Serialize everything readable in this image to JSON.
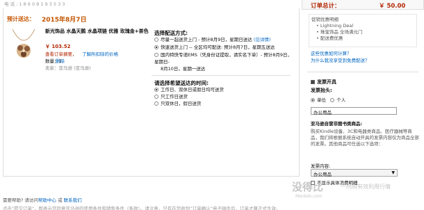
{
  "top_partial": "电 话 : 1 8 6 0 8 1 9 3 5 3 3",
  "shipment": {
    "estimate_label": "预计送达：",
    "estimate_date": "2015年8月7日"
  },
  "product": {
    "title": "新光饰品 水晶天鹅 水晶项链 优雅 玫瑰金+茶色",
    "price": "￥ 103.52",
    "promo_text": "查看订单摘要，",
    "promo_link": "了解所扣除的价格",
    "qty": "数量：1",
    "delete": "删除",
    "seller": "卖家：亚马逊 (亚马逊)"
  },
  "shipping": {
    "title": "选择配送方式:",
    "options": [
      {
        "label": "尽量一起送货上门 - 预计8月9日，星期日送达",
        "link": "(见详情)",
        "selected": false
      },
      {
        "label": "快速送货上门 -- 全区均可配送: 预计8月7日，星期五送达",
        "link": "",
        "selected": true
      },
      {
        "label": "国内特快专递EMS（凭身份证提取，请实名下单）- 预计8月9日，星期日-",
        "link": "",
        "selected": false
      },
      {
        "label": "8月10日，星期一送达",
        "link": "",
        "selected": false
      }
    ]
  },
  "time": {
    "title": "请选择希望送达的时间:",
    "options": [
      {
        "label": "工作日、双休日或假日均可送货",
        "selected": true
      },
      {
        "label": "只工作日送货",
        "selected": false
      },
      {
        "label": "只双休日，假日送货",
        "selected": false
      }
    ]
  },
  "summary": {
    "total_label": "订单总计：",
    "total_value": "￥ 50.00",
    "promos": [
      "促销优惠明细",
      "• Lightning Deal",
      "• 珠宝饰品 全场满元门",
      "• 配送费优惠"
    ],
    "link1": "这些优惠如何计算？",
    "link2": "为什么我没享受到免费配送？"
  },
  "invoice": {
    "need_label": "发票开具",
    "header_label": "发票抬头:",
    "unit_label": "单位",
    "person_label": "个人",
    "header_value": "办公用品",
    "category_label": "亚马逊自营非图书类商品:",
    "desc": "购买Kindle设备、3C和电器类商品、医疗器械等商品，我们将根据系统自动开具的发票内容仅为商品全部的发票。其他商品可任选以下选项：",
    "content_label": "发票内容:",
    "content_value": "办公用品",
    "no_detail": "不显示具体消费明细"
  },
  "help": {
    "prefix": "需要帮助? 请访问",
    "help_link": "帮助中心",
    "mid": " 或 ",
    "contact_link": "联系我们"
  },
  "footer": "点击\"提交订单\"，即表示您同意亚马逊的使用条件和销售条件（条款）。请注意，只有在您收到“订单确认”电子邮件后，订单才算正式生效。",
  "watermark": {
    "brand": "没得比",
    "slogan": "一同购有效利用行情",
    "url": "Meidebi.com"
  }
}
